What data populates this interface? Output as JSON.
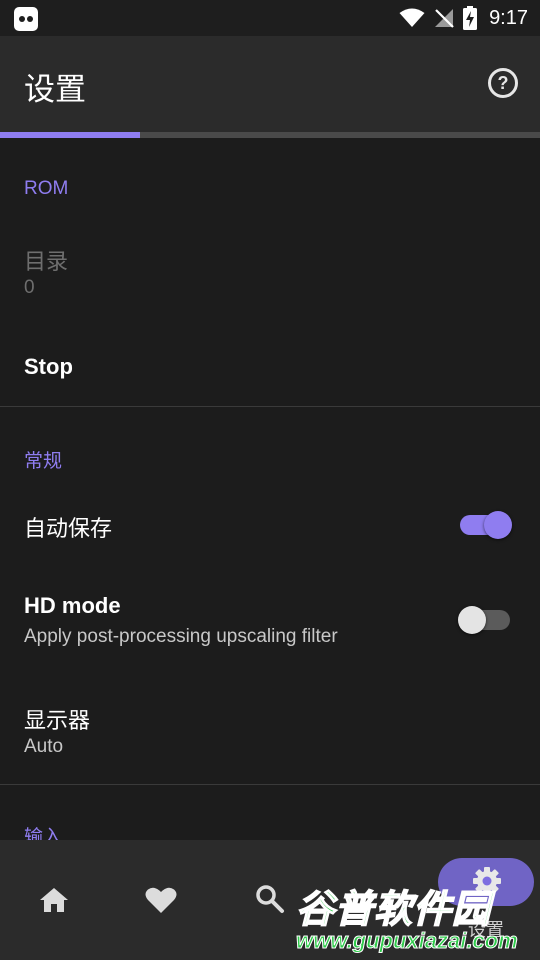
{
  "status_bar": {
    "time": "9:17",
    "icons": [
      "app-icon",
      "wifi-icon",
      "signal-off-icon",
      "battery-charging-icon"
    ]
  },
  "app_bar": {
    "title": "设置",
    "help_icon": "help-icon",
    "help_glyph": "?"
  },
  "progress": {
    "value_percent": 26
  },
  "colors": {
    "accent": "#8f7df0",
    "background": "#1c1c1c",
    "app_bar": "#2b2b2b",
    "watermark_green": "#2ecb4a"
  },
  "sections": {
    "rom": {
      "header": "ROM",
      "directory": {
        "title": "目录",
        "summary": "0",
        "enabled": false
      },
      "stop": {
        "title": "Stop"
      }
    },
    "general": {
      "header": "常规",
      "autosave": {
        "title": "自动保存",
        "checked": true
      },
      "hd_mode": {
        "title": "HD mode",
        "summary": "Apply post-processing upscaling filter",
        "checked": false
      },
      "display": {
        "title": "显示器",
        "summary": "Auto"
      }
    },
    "input": {
      "header": "输入"
    }
  },
  "bottom_nav": {
    "items": [
      {
        "icon": "home-icon"
      },
      {
        "icon": "heart-icon"
      },
      {
        "icon": "search-icon"
      },
      {
        "icon": "gear-icon",
        "label": "设置",
        "active": true
      }
    ]
  },
  "watermark": {
    "title": "谷普软件园",
    "url": "www.gupuxiazai.com"
  }
}
